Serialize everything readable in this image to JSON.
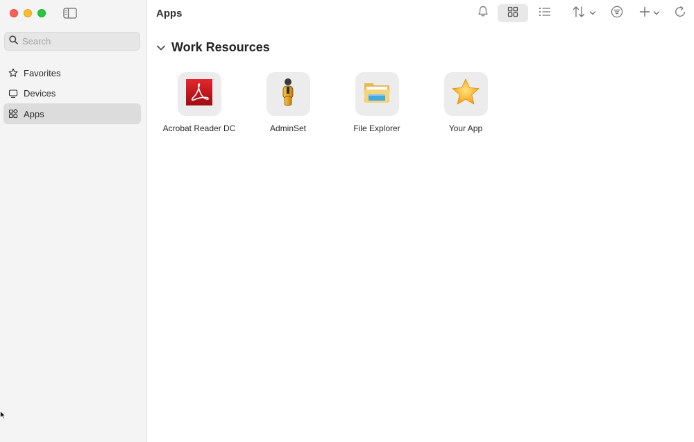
{
  "window": {
    "title": "Apps"
  },
  "search": {
    "placeholder": "Search"
  },
  "sidebar": {
    "items": [
      {
        "label": "Favorites",
        "icon": "star-outline-icon"
      },
      {
        "label": "Devices",
        "icon": "monitor-icon"
      },
      {
        "label": "Apps",
        "icon": "apps-icon",
        "selected": true
      }
    ]
  },
  "toolbar": {
    "icons": [
      "bell-icon",
      "grid-view-icon",
      "list-view-icon",
      "sort-icon",
      "filter-icon",
      "add-icon",
      "refresh-icon"
    ],
    "active_view": "grid"
  },
  "section": {
    "label": "Work Resources",
    "expanded": true
  },
  "apps": [
    {
      "name": "Acrobat Reader DC",
      "icon": "acrobat-icon"
    },
    {
      "name": "AdminSet",
      "icon": "adminset-icon"
    },
    {
      "name": "File Explorer",
      "icon": "folder-icon"
    },
    {
      "name": "Your App",
      "icon": "star-icon"
    }
  ],
  "colors": {
    "close": "#fe5f57",
    "minimize": "#febc2e",
    "maximize": "#28c840",
    "acrobat_red": "#c4161c",
    "star": "#f5a623"
  }
}
